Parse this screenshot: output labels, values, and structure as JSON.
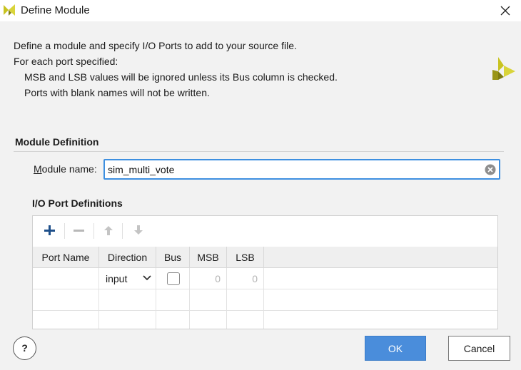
{
  "window": {
    "title": "Define Module",
    "logo_icon": "vivado-logo-icon",
    "close_icon": "close-icon"
  },
  "description": {
    "line1": "Define a module and specify I/O Ports to add to your source file.",
    "line2": "For each port specified:",
    "line3": "MSB and LSB values will be ignored unless its Bus column is checked.",
    "line4": "Ports with blank names will not be written."
  },
  "module_definition": {
    "section_title": "Module Definition",
    "name_label_underlined": "M",
    "name_label_rest": "odule name:",
    "name_value": "sim_multi_vote",
    "clear_icon": "clear-icon"
  },
  "io_ports": {
    "section_title": "I/O Port Definitions",
    "toolbar": [
      "add-icon",
      "remove-icon",
      "move-up-icon",
      "move-down-icon"
    ],
    "columns": [
      "Port Name",
      "Direction",
      "Bus",
      "MSB",
      "LSB"
    ],
    "rows": [
      {
        "port_name": "",
        "direction": "input",
        "bus": false,
        "msb": "0",
        "lsb": "0"
      }
    ]
  },
  "footer": {
    "help_label": "?",
    "ok_label": "OK",
    "cancel_label": "Cancel"
  },
  "colors": {
    "accent": "#4a8ddb",
    "focus_border": "#3d8fe0",
    "logo_yellow": "#c8c321",
    "logo_dark": "#7d7b10"
  }
}
